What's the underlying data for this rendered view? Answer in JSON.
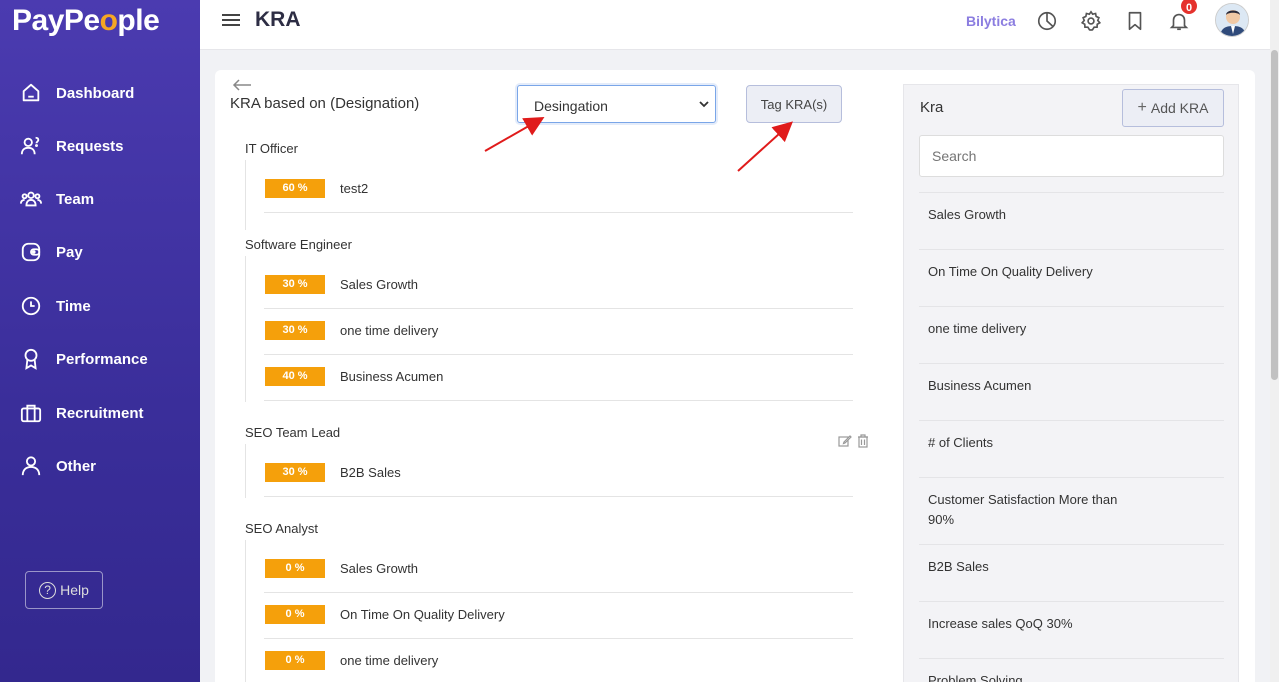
{
  "brand": {
    "logo_pre": "PayPe",
    "logo_o": "o",
    "logo_post": "ple",
    "accent": "#f6a623",
    "sidebar_color": "#3f33a3"
  },
  "sidebar": {
    "items": [
      {
        "label": "Dashboard",
        "icon": "home-icon"
      },
      {
        "label": "Requests",
        "icon": "user-question-icon"
      },
      {
        "label": "Team",
        "icon": "team-icon"
      },
      {
        "label": "Pay",
        "icon": "wallet-icon"
      },
      {
        "label": "Time",
        "icon": "clock-icon"
      },
      {
        "label": "Performance",
        "icon": "award-icon"
      },
      {
        "label": "Recruitment",
        "icon": "briefcase-icon"
      },
      {
        "label": "Other",
        "icon": "user-icon"
      }
    ],
    "help_label": "Help"
  },
  "header": {
    "title": "KRA",
    "company": "Bilytica",
    "notification_count": "0"
  },
  "main": {
    "title": "KRA based on (Designation)",
    "select_value": "Desingation",
    "tag_button": "Tag KRA(s)",
    "pct_color": "#f5a00b",
    "groups": [
      {
        "name": "IT Officer",
        "kras": [
          {
            "pct": "60 %",
            "name": "test2"
          }
        ]
      },
      {
        "name": "Software Engineer",
        "kras": [
          {
            "pct": "30 %",
            "name": "Sales Growth"
          },
          {
            "pct": "30 %",
            "name": "one time delivery"
          },
          {
            "pct": "40 %",
            "name": "Business Acumen"
          }
        ]
      },
      {
        "name": "SEO Team Lead",
        "kras": [
          {
            "pct": "30 %",
            "name": "B2B Sales"
          }
        ]
      },
      {
        "name": "SEO Analyst",
        "kras": [
          {
            "pct": "0 %",
            "name": "Sales Growth"
          },
          {
            "pct": "0 %",
            "name": "On Time On Quality Delivery"
          },
          {
            "pct": "0 %",
            "name": "one time delivery"
          }
        ]
      }
    ]
  },
  "kra_panel": {
    "title": "Kra",
    "add_button": "Add KRA",
    "search_placeholder": "Search",
    "items": [
      "Sales Growth",
      "On Time On Quality Delivery",
      "one time delivery",
      "Business Acumen",
      "# of Clients",
      "Customer Satisfaction More than 90%",
      "B2B Sales",
      "Increase sales QoQ 30%",
      "Problem Solving"
    ]
  }
}
